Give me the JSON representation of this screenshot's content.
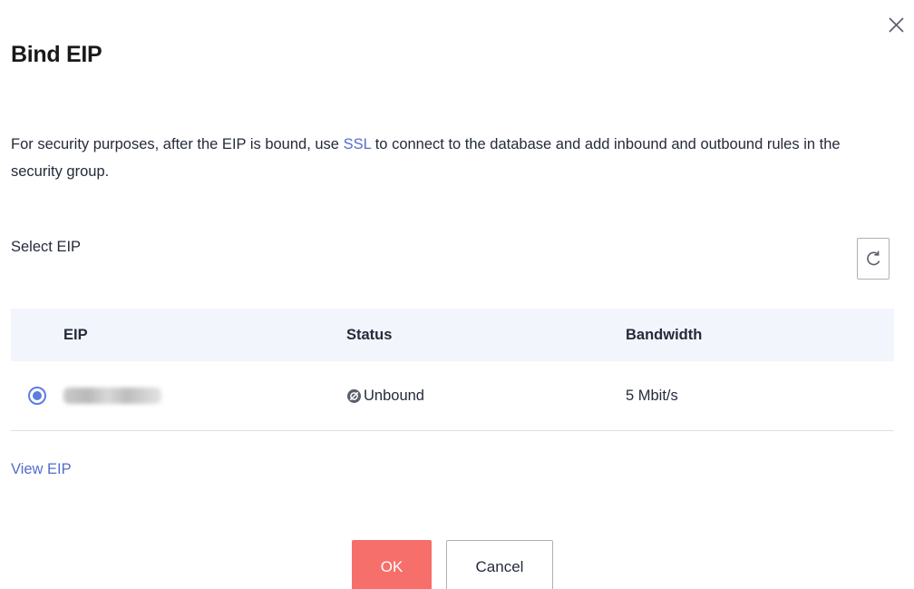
{
  "dialog": {
    "title": "Bind EIP",
    "close_icon": "close-icon"
  },
  "notice": {
    "text_before": "For security purposes, after the EIP is bound, use ",
    "link": "SSL",
    "text_after": " to connect to the database and add inbound and outbound rules in the security group."
  },
  "select": {
    "label": "Select EIP",
    "refresh_icon": "refresh-icon"
  },
  "table": {
    "columns": [
      "EIP",
      "Status",
      "Bandwidth"
    ],
    "rows": [
      {
        "selected": true,
        "eip": "",
        "status": "Unbound",
        "status_icon": "unbound-status-icon",
        "bandwidth": "5 Mbit/s"
      }
    ]
  },
  "view_link": "View EIP",
  "footer": {
    "ok_label": "OK",
    "cancel_label": "Cancel"
  },
  "colors": {
    "primary": "#5e7ce0",
    "link": "#526ecc",
    "ok_button": "#f66f6a",
    "table_header_bg": "#f2f5fc"
  }
}
